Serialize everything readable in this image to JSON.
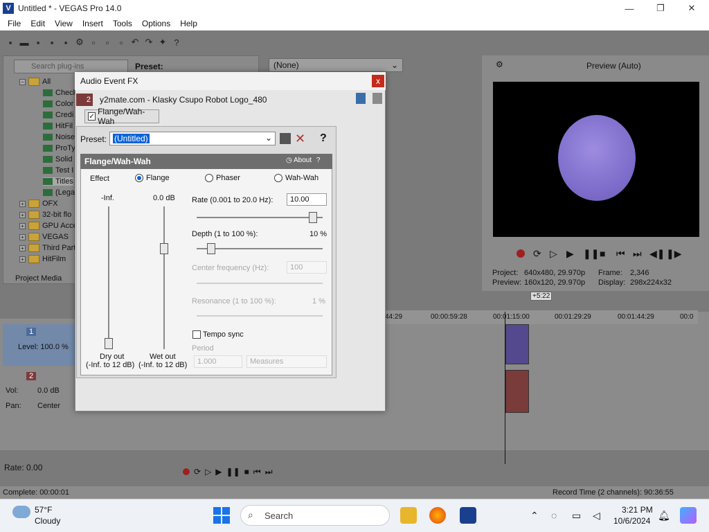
{
  "window": {
    "title": "Untitled * - VEGAS Pro 14.0",
    "app_icon": "vegas-icon",
    "minimize": "—",
    "maximize": "❐",
    "close": "✕"
  },
  "menu": [
    "File",
    "Edit",
    "View",
    "Insert",
    "Tools",
    "Options",
    "Help"
  ],
  "explorer": {
    "search_placeholder": "Search plug-ins",
    "preset_label": "Preset:",
    "tree": [
      "All",
      "Check",
      "Color",
      "Credi",
      "HitFil",
      "Noise",
      "ProTy",
      "Solid",
      "Test I",
      "Titles",
      "(Lega",
      "OFX",
      "32-bit flo",
      "GPU Acce",
      "VEGAS",
      "Third Part",
      "HitFilm"
    ],
    "tab_label": "Project Media"
  },
  "fx_combo": {
    "value": "(None)"
  },
  "preview": {
    "mode_label": "Preview (Auto)",
    "project_label": "Project:",
    "project_value": "640x480, 29.970p",
    "preview_label": "Preview:",
    "preview_value": "160x120, 29.970p",
    "frame_label": "Frame:",
    "frame_value": "2,346",
    "display_label": "Display:",
    "display_value": "298x224x32"
  },
  "timeline": {
    "ruler": [
      "44:29",
      "00:00:59:28",
      "00:01:15:00",
      "00:01:29:29",
      "00:01:44:29",
      "00:0"
    ],
    "loop_badge": "+5:22",
    "track1": {
      "number": "1",
      "level": "Level: 100.0 %"
    },
    "track2": {
      "number": "2",
      "vol_label": "Vol:",
      "vol_value": "0.0 dB",
      "pan_label": "Pan:",
      "pan_value": "Center"
    }
  },
  "transport": {
    "rate": "Rate: 0.00"
  },
  "status": {
    "complete": "Complete: 00:00:01",
    "record_time": "Record Time (2 channels): 90:36:55"
  },
  "dialog": {
    "title": "Audio Event FX",
    "close": "x",
    "event_number": "2",
    "event_name": "y2mate.com - Klasky Csupo Robot Logo_480",
    "chain_item": "Flange/Wah-Wah",
    "preset_label": "Preset:",
    "preset_value": "(Untitled)",
    "help": "?",
    "plugin": {
      "name": "Flange/Wah-Wah",
      "about": "About",
      "about_q": "?",
      "effect_label": "Effect",
      "effect_options": [
        "Flange",
        "Phaser",
        "Wah-Wah"
      ],
      "effect_selected": "Flange",
      "dry_top": "-Inf.",
      "wet_top": "0.0 dB",
      "dry_label": "Dry out",
      "dry_range": "(-Inf. to 12 dB)",
      "wet_label": "Wet out",
      "wet_range": "(-Inf. to 12 dB)",
      "dry_level": 0.0,
      "wet_level": 0.72,
      "rate_label": "Rate (0.001 to 20.0 Hz):",
      "rate_value": "10.00",
      "rate_fraction": 0.95,
      "depth_label": "Depth (1 to 100 %):",
      "depth_value": "10 %",
      "depth_fraction": 0.09,
      "center_label": "Center frequency (Hz):",
      "center_value": "100",
      "resonance_label": "Resonance (1 to 100 %):",
      "resonance_value": "1 %",
      "tempo_label": "Tempo sync",
      "period_label": "Period",
      "period_value": "1.000",
      "measures_value": "Measures"
    }
  },
  "taskbar": {
    "temp": "57°F",
    "condition": "Cloudy",
    "search": "Search",
    "time": "3:21 PM",
    "date": "10/6/2024"
  },
  "colors": {
    "accent": "#0a64d8",
    "close_red": "#c42b1c",
    "preview_circle": "#8474d0"
  }
}
